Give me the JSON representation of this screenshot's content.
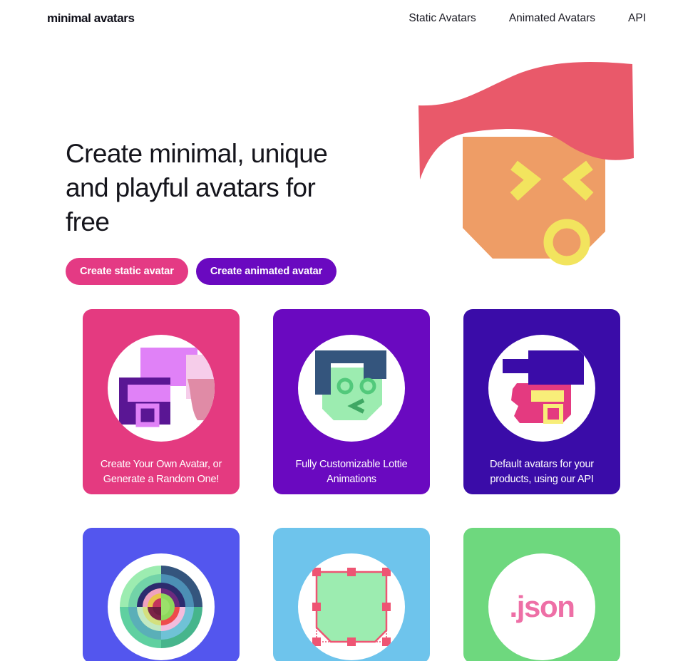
{
  "header": {
    "brand": "minimal avatars",
    "nav": [
      {
        "label": "Static Avatars",
        "name": "nav-static-avatars"
      },
      {
        "label": "Animated Avatars",
        "name": "nav-animated-avatars"
      },
      {
        "label": "API",
        "name": "nav-api"
      }
    ]
  },
  "hero": {
    "title": "Create minimal, unique and playful avatars for free",
    "buttons": {
      "static": "Create static avatar",
      "animated": "Create animated avatar"
    },
    "illustration": {
      "name": "hero-avatar-illustration",
      "hair_color": "#E9596A",
      "face_color": "#EE9D66",
      "feature_color": "#F2E45E"
    }
  },
  "cards": [
    {
      "name": "card-create-your-own-avatar",
      "label": "Create Your Own Avatar, or Generate a Random One!",
      "bg": "#E43A80",
      "art": "avatar-pink-purple"
    },
    {
      "name": "card-lottie-animations",
      "label": "Fully Customizable Lottie Animations",
      "bg": "#6A09C0",
      "art": "avatar-green-navy"
    },
    {
      "name": "card-default-avatars-api",
      "label": "Default avatars for your products, using our API",
      "bg": "#3A0CA8",
      "art": "avatar-indigo-pink"
    },
    {
      "name": "card-color-wheel",
      "label": "",
      "bg": "#5356EE",
      "art": "color-wheel"
    },
    {
      "name": "card-vector-shape",
      "label": "",
      "bg": "#6EC4EC",
      "art": "vector-polygon"
    },
    {
      "name": "card-json-export",
      "label": "",
      "bg": "#6ED87E",
      "art": "json-label",
      "art_text": ".json"
    }
  ],
  "colors": {
    "pink": "#E43A80",
    "purple": "#6A09C0",
    "indigo": "#3A0CA8",
    "blue": "#5356EE",
    "light_blue": "#6EC4EC",
    "green": "#6ED87E",
    "yellow": "#F2E45E",
    "coral": "#E9596A",
    "skin": "#EE9D66",
    "json_pink": "#EE6FA6"
  }
}
